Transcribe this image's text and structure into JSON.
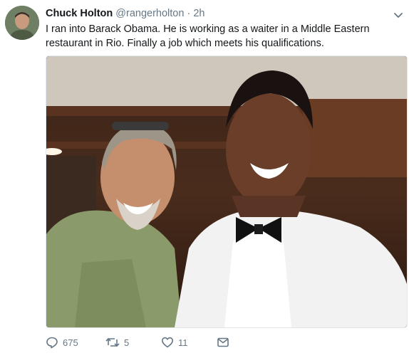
{
  "tweet": {
    "author_name": "Chuck Holton",
    "author_handle": "@rangerholton",
    "separator": "·",
    "time": "2h",
    "text": "I ran into Barack Obama. He is working as a waiter in a Middle Eastern restaurant in Rio.  Finally a job which meets his qualifications.",
    "actions": {
      "replies": "675",
      "retweets": "5",
      "likes": "11"
    }
  },
  "icons": {
    "caret": "chevron-down-icon",
    "reply": "reply-icon",
    "retweet": "retweet-icon",
    "like": "heart-icon",
    "message": "direct-message-icon"
  },
  "colors": {
    "text": "#14171a",
    "secondary": "#657786",
    "border": "#e1e8ed"
  }
}
